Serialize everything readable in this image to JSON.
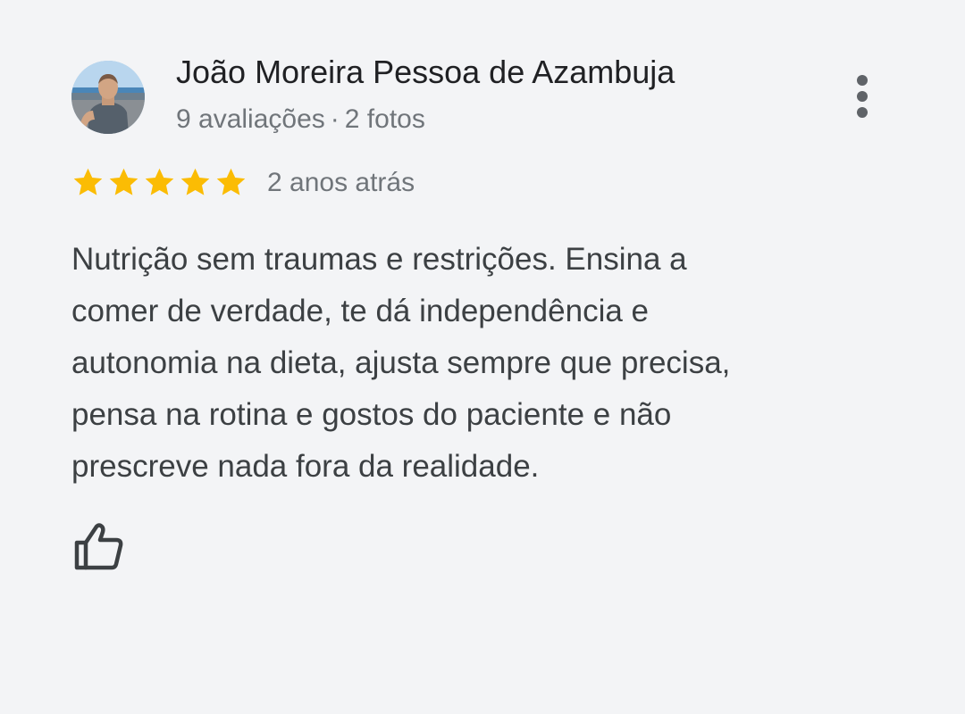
{
  "reviewer": {
    "name": "João Moreira Pessoa de Azambuja",
    "reviews_count": "9 avaliações",
    "separator": "·",
    "photos_count": "2 fotos"
  },
  "rating": {
    "stars": 5,
    "max_stars": 5,
    "star_color": "#fbbc04"
  },
  "review": {
    "date": "2 anos atrás",
    "text_lines": [
      "Nutrição sem traumas e restrições. Ensina a",
      "comer de verdade, te dá independência e",
      "autonomia na dieta, ajusta sempre que precisa,",
      "pensa na rotina e gostos do paciente e não",
      "prescreve nada fora da realidade."
    ]
  },
  "icons": {
    "more": "more-vert-icon",
    "like": "thumb-up-icon",
    "star": "star-icon"
  }
}
